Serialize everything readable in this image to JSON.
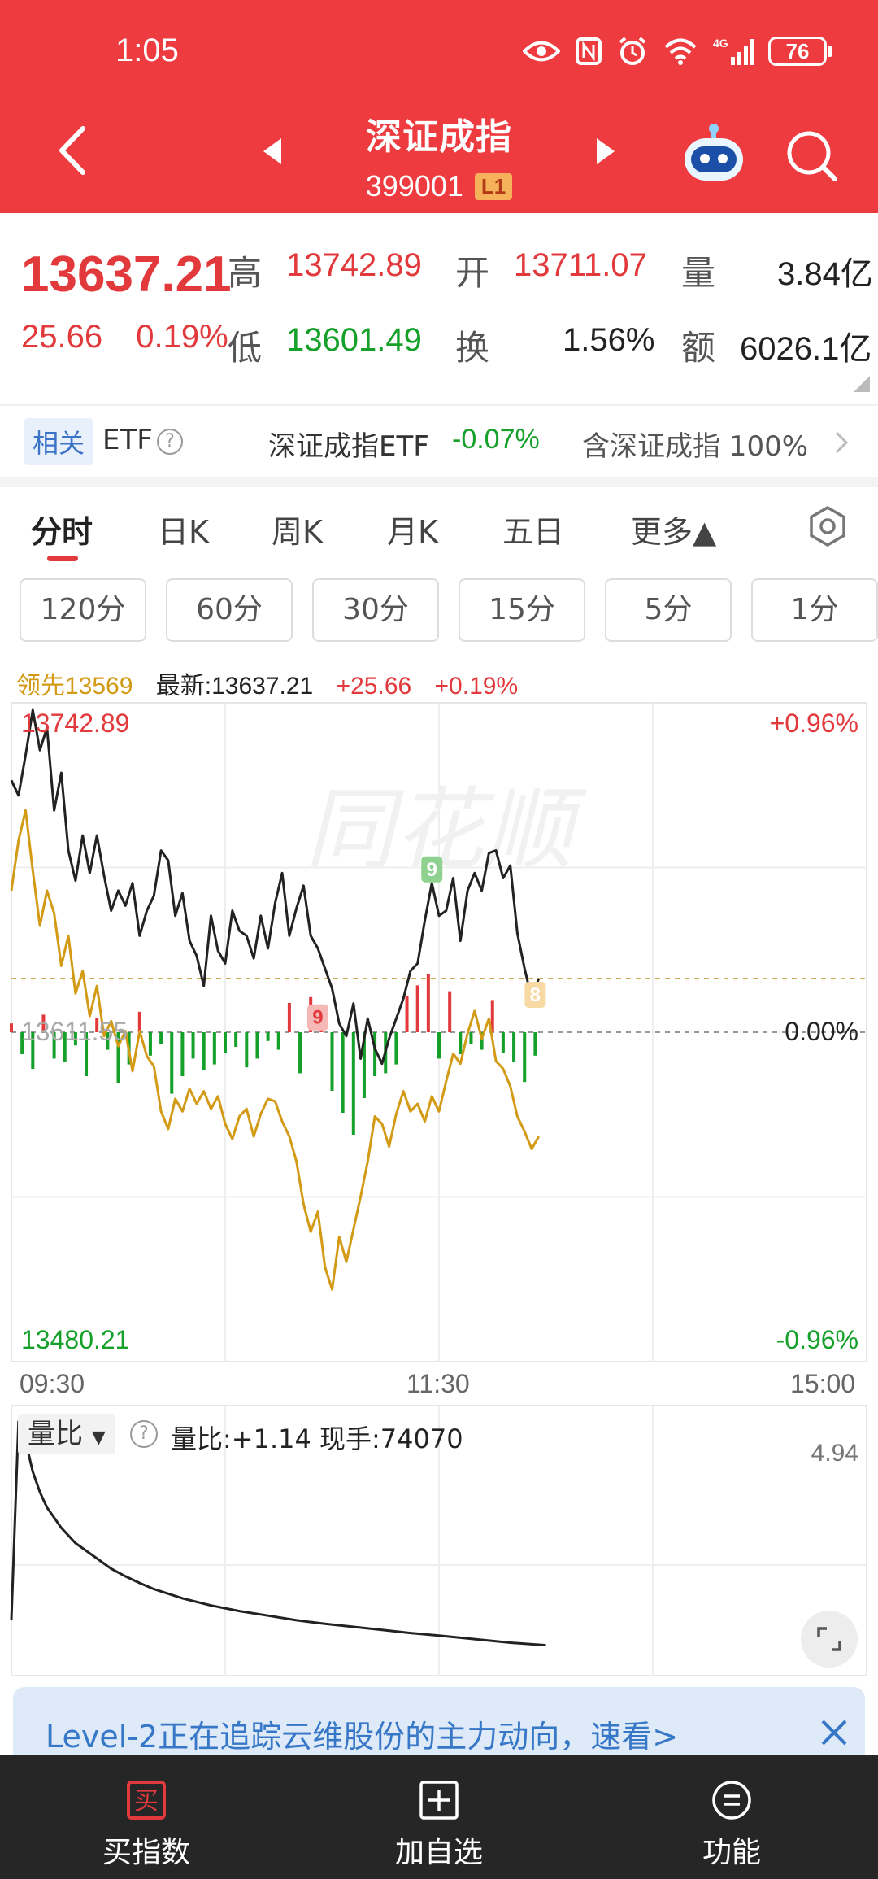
{
  "status_bar": {
    "time": "1:05",
    "battery": "76",
    "network": "4G"
  },
  "header": {
    "title": "深证成指",
    "code": "399001",
    "level": "L1"
  },
  "quote": {
    "price": "13637.21",
    "change": "25.66",
    "change_pct": "0.19%",
    "high_label": "高",
    "high": "13742.89",
    "low_label": "低",
    "low": "13601.49",
    "open_label": "开",
    "open": "13711.07",
    "turnover_label": "换",
    "turnover": "1.56%",
    "volume_label": "量",
    "volume": "3.84亿",
    "amount_label": "额",
    "amount": "6026.1亿"
  },
  "related": {
    "tag": "相关",
    "etf": "ETF",
    "etf_name": "深证成指ETF",
    "etf_change": "-0.07%",
    "contains": "含深证成指 100%"
  },
  "tabs": [
    {
      "label": "分时",
      "active": true
    },
    {
      "label": "日K"
    },
    {
      "label": "周K"
    },
    {
      "label": "月K"
    },
    {
      "label": "五日"
    },
    {
      "label": "更多▲"
    }
  ],
  "minute_buttons": [
    "120分",
    "60分",
    "30分",
    "15分",
    "5分",
    "1分"
  ],
  "chart_info": {
    "lead": "领先13569",
    "latest": "最新:13637.21",
    "change": "+25.66",
    "change_pct": "+0.19%"
  },
  "colors": {
    "header_bg": "#ee3b3f",
    "up": "#e23a3c",
    "down": "#15a02a",
    "lead_line": "#d39a15",
    "price_line": "#222222"
  },
  "chart_data": {
    "type": "line",
    "y_top_label": "13742.89",
    "y_bottom_label": "13480.21",
    "y_baseline_label": "13611.55",
    "pct_top": "+0.96%",
    "pct_mid": "0.00%",
    "pct_bottom": "-0.96%",
    "x_tick_labels": [
      "09:30",
      "11:30",
      "15:00"
    ],
    "ylim": [
      13480.21,
      13742.89
    ],
    "baseline": 13611.55,
    "x_domain": [
      0,
      240
    ],
    "markers": [
      {
        "label": "9",
        "minute": 118,
        "price": 13670,
        "color": "green"
      },
      {
        "label": "9",
        "minute": 86,
        "price": 13611,
        "color": "red"
      },
      {
        "label": "8",
        "minute": 147,
        "price": 13620,
        "color": "orange"
      }
    ],
    "series": [
      {
        "name": "最新",
        "x": [
          0,
          2,
          4,
          6,
          8,
          10,
          12,
          14,
          16,
          18,
          20,
          22,
          24,
          26,
          28,
          30,
          32,
          34,
          36,
          38,
          40,
          42,
          44,
          46,
          48,
          50,
          52,
          54,
          56,
          58,
          60,
          62,
          64,
          66,
          68,
          70,
          72,
          74,
          76,
          78,
          80,
          82,
          84,
          86,
          88,
          90,
          92,
          94,
          96,
          98,
          100,
          102,
          104,
          106,
          108,
          110,
          112,
          114,
          116,
          118,
          120,
          122,
          124,
          126,
          128,
          130,
          132,
          134,
          136,
          138,
          140,
          142,
          144,
          146,
          148
        ],
        "y": [
          13712,
          13706,
          13722,
          13740,
          13724,
          13733,
          13700,
          13715,
          13684,
          13672,
          13690,
          13675,
          13690,
          13674,
          13660,
          13668,
          13662,
          13671,
          13650,
          13660,
          13666,
          13684,
          13680,
          13658,
          13667,
          13648,
          13642,
          13630,
          13658,
          13644,
          13639,
          13660,
          13652,
          13650,
          13641,
          13658,
          13645,
          13663,
          13675,
          13650,
          13661,
          13670,
          13650,
          13645,
          13637,
          13629,
          13615,
          13610,
          13623,
          13601,
          13617,
          13605,
          13599,
          13609,
          13617,
          13625,
          13636,
          13639,
          13656,
          13671,
          13658,
          13660,
          13673,
          13648,
          13668,
          13675,
          13668,
          13683,
          13684,
          13673,
          13678,
          13651,
          13637,
          13625,
          13633
        ]
      },
      {
        "name": "领先",
        "x": [
          0,
          2,
          4,
          6,
          8,
          10,
          12,
          14,
          16,
          18,
          20,
          22,
          24,
          26,
          28,
          30,
          32,
          34,
          36,
          38,
          40,
          42,
          44,
          46,
          48,
          50,
          52,
          54,
          56,
          58,
          60,
          62,
          64,
          66,
          68,
          70,
          72,
          74,
          76,
          78,
          80,
          82,
          84,
          86,
          88,
          90,
          92,
          94,
          96,
          98,
          100,
          102,
          104,
          106,
          108,
          110,
          112,
          114,
          116,
          118,
          120,
          122,
          124,
          126,
          128,
          130,
          132,
          134,
          136,
          138,
          140,
          142,
          144,
          146,
          148
        ],
        "y": [
          13668,
          13688,
          13700,
          13676,
          13654,
          13668,
          13659,
          13638,
          13650,
          13627,
          13636,
          13618,
          13630,
          13610,
          13616,
          13606,
          13612,
          13596,
          13612,
          13602,
          13598,
          13580,
          13573,
          13585,
          13580,
          13589,
          13583,
          13588,
          13581,
          13586,
          13575,
          13569,
          13578,
          13581,
          13570,
          13579,
          13585,
          13584,
          13576,
          13570,
          13560,
          13543,
          13532,
          13540,
          13518,
          13509,
          13530,
          13520,
          13533,
          13546,
          13560,
          13578,
          13575,
          13566,
          13579,
          13588,
          13580,
          13583,
          13576,
          13586,
          13580,
          13592,
          13603,
          13599,
          13611,
          13620,
          13609,
          13617,
          13600,
          13597,
          13590,
          13578,
          13572,
          13565,
          13570
        ]
      }
    ],
    "volume_bars": {
      "x": [
        0,
        3,
        6,
        9,
        12,
        15,
        18,
        21,
        24,
        27,
        30,
        33,
        36,
        39,
        42,
        45,
        48,
        51,
        54,
        57,
        60,
        63,
        66,
        69,
        72,
        75,
        78,
        81,
        84,
        87,
        90,
        93,
        96,
        99,
        102,
        105,
        108,
        111,
        114,
        117,
        120,
        123,
        126,
        129,
        132,
        135,
        138,
        141,
        144,
        147
      ],
      "v": [
        6,
        -15,
        -25,
        12,
        -18,
        -20,
        -9,
        -30,
        10,
        -12,
        -35,
        -22,
        14,
        -16,
        -8,
        -42,
        -30,
        -18,
        -26,
        -22,
        -14,
        -10,
        -24,
        -18,
        -6,
        -12,
        20,
        -28,
        24,
        10,
        -40,
        -55,
        -70,
        -45,
        -30,
        -28,
        -22,
        25,
        32,
        40,
        -18,
        28,
        -15,
        -8,
        -12,
        22,
        -14,
        -20,
        -34,
        -16
      ]
    }
  },
  "volume_ratio": {
    "selector": "量比",
    "info": "量比:+1.14  现手:74070",
    "max_label": "4.94",
    "chart_data": {
      "type": "line",
      "ylim": [
        0,
        4.94
      ],
      "x": [
        0,
        2,
        4,
        6,
        8,
        10,
        12,
        14,
        16,
        18,
        20,
        24,
        28,
        32,
        36,
        40,
        48,
        56,
        64,
        72,
        80,
        88,
        96,
        104,
        112,
        120,
        130,
        140,
        150
      ],
      "y": [
        1.0,
        4.9,
        4.5,
        3.9,
        3.5,
        3.2,
        3.0,
        2.8,
        2.65,
        2.5,
        2.4,
        2.2,
        2.0,
        1.85,
        1.72,
        1.6,
        1.42,
        1.28,
        1.17,
        1.08,
        0.99,
        0.92,
        0.86,
        0.8,
        0.74,
        0.69,
        0.62,
        0.55,
        0.5
      ]
    }
  },
  "banner": {
    "text": "Level-2正在追踪云维股份的主力动向，速看>"
  },
  "bottom_nav": [
    {
      "label": "买指数",
      "icon": "buy-icon"
    },
    {
      "label": "加自选",
      "icon": "add-icon"
    },
    {
      "label": "功能",
      "icon": "menu-icon"
    }
  ]
}
